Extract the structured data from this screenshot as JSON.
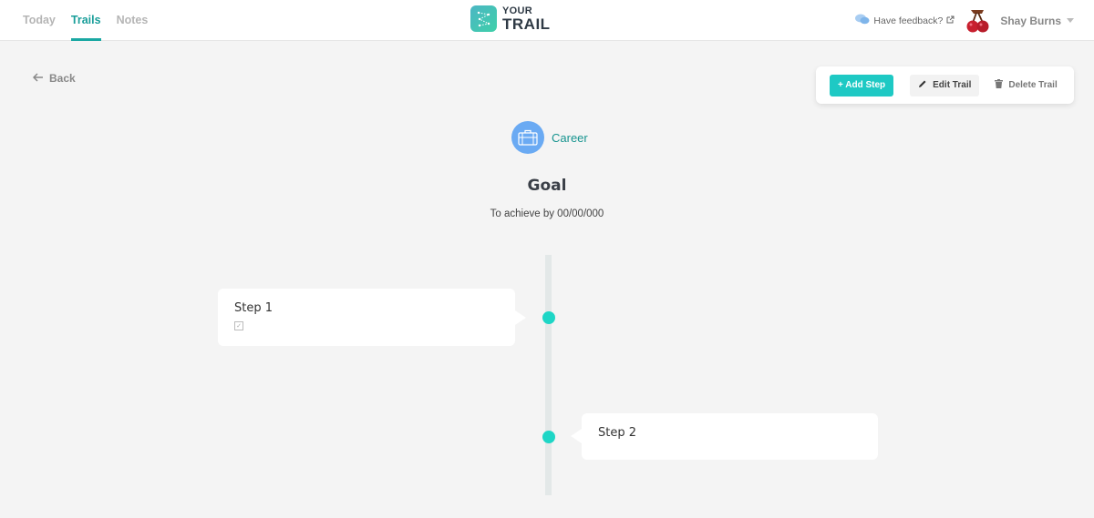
{
  "nav": {
    "tabs": [
      {
        "label": "Today",
        "active": false
      },
      {
        "label": "Trails",
        "active": true
      },
      {
        "label": "Notes",
        "active": false
      }
    ]
  },
  "logo": {
    "line1": "YOUR",
    "line2": "TRAIL"
  },
  "header": {
    "feedback_label": "Have feedback?",
    "user_name": "Shay Burns"
  },
  "back_label": "Back",
  "actions": {
    "add_step_label": "+ Add Step",
    "edit_trail_label": "Edit Trail",
    "delete_trail_label": "Delete Trail"
  },
  "trail": {
    "category": "Career",
    "goal_title": "Goal",
    "goal_date": "To achieve by 00/00/000",
    "steps": [
      {
        "title": "Step 1",
        "has_checkbox": true,
        "side": "left"
      },
      {
        "title": "Step 2",
        "has_checkbox": false,
        "side": "right"
      }
    ]
  },
  "colors": {
    "accent": "#1ec9c4",
    "active_tab": "#1a9e9a",
    "category_icon_bg": "#6aaaf3",
    "timeline_dot": "#1ed6c6"
  }
}
